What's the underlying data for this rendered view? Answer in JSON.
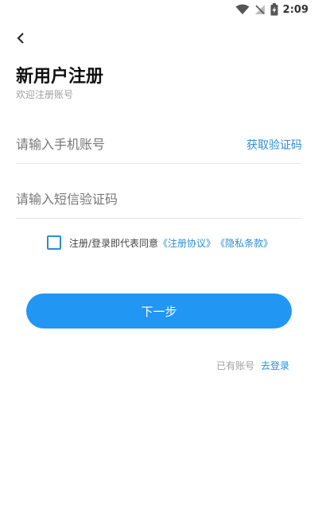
{
  "status_bar": {
    "time": "2:09",
    "icons": [
      "wifi-icon",
      "signal-off-icon",
      "battery-charging-icon"
    ]
  },
  "header": {
    "back_icon": "chevron-left-icon",
    "title": "新用户注册",
    "subtitle": "欢迎注册账号"
  },
  "form": {
    "phone_placeholder": "请输入手机账号",
    "phone_value": "",
    "get_code_label": "获取验证码",
    "code_placeholder": "请输入短信验证码",
    "code_value": ""
  },
  "agreement": {
    "checked": false,
    "text": "注册/登录即代表同意",
    "terms_link": "《注册协议》",
    "privacy_link": "《隐私条款》"
  },
  "actions": {
    "next_label": "下一步",
    "login_hint": "已有账号",
    "login_link": "去登录"
  },
  "colors": {
    "accent": "#2196f3",
    "link": "#2b8ed6",
    "muted": "#a0a0a0"
  }
}
